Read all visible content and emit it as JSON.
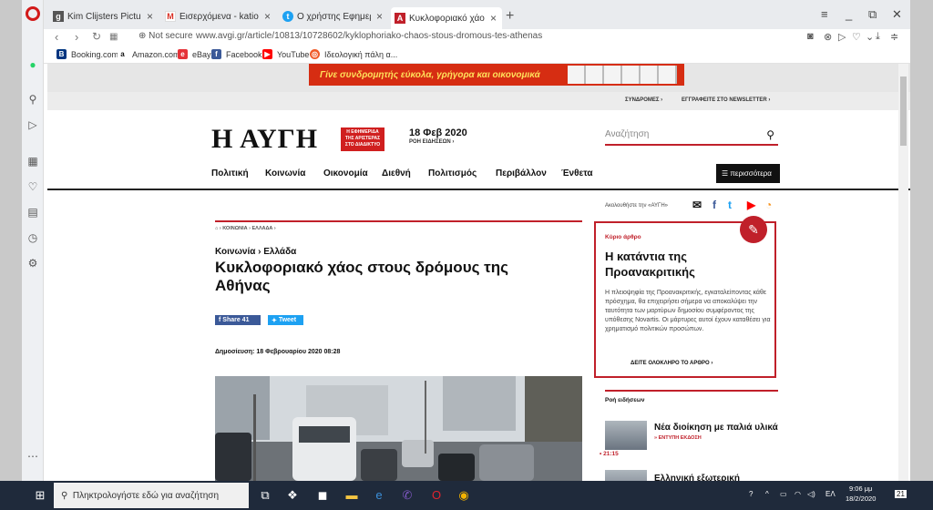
{
  "browser": {
    "tabs": [
      {
        "favicon": "g",
        "title": "Kim Clijsters Pictures and I",
        "color": "#555555"
      },
      {
        "favicon": "M",
        "title": "Εισερχόμενα - katiousa.gr",
        "color": "#d93025"
      },
      {
        "favicon": "t",
        "title": "Ο χρήστης Εφημερίδα Η Α",
        "color": "#1da1f2"
      },
      {
        "favicon": "A",
        "title": "Κυκλοφοριακό χάος στου",
        "color": "#c0202a"
      }
    ],
    "security_label": "Not secure",
    "url": "www.avgi.gr/article/10813/10728602/kyklophoriako-chaos-stous-dromous-tes-athenas",
    "bookmarks": [
      {
        "label": "Booking.com",
        "icon": "booking-icon",
        "color": "#003580"
      },
      {
        "label": "Amazon.com",
        "icon": "amazon-icon",
        "color": "#111111"
      },
      {
        "label": "eBay",
        "icon": "ebay-icon",
        "color": "#e53238"
      },
      {
        "label": "Facebook",
        "icon": "facebook-icon",
        "color": "#3b5998"
      },
      {
        "label": "YouTube",
        "icon": "youtube-icon",
        "color": "#ff0000"
      },
      {
        "label": "Ιδεολογική πάλη α...",
        "icon": "ideologiki-icon",
        "color": "#f05a28"
      }
    ]
  },
  "ad": {
    "text": "Γίνε συνδρομητής εύκολα, γρήγορα και οικονομικά"
  },
  "topbar": {
    "subscriptions": "ΣΥΝΔΡΟΜΕΣ ›",
    "newsletter": "ΕΓΓΡΑΦΕΙΤΕ ΣΤΟ NEWSLETTER ›"
  },
  "site": {
    "logo": "Η ΑΥΓΗ",
    "logo_tagline": "Η ΕΦΗΜΕΡΙΔΑ ΤΗΣ ΑΡΙΣΤΕΡΑΣ ΣΤΟ ΔΙΑΔΙΚΤΥΟ",
    "date": "18 Φεβ 2020",
    "news_flow": "ΡΟΗ ΕΙΔΗΣΕΩΝ ›",
    "search_placeholder": "Αναζήτηση",
    "menu": [
      "Πολιτική",
      "Κοινωνία",
      "Οικονομία",
      "Διεθνή",
      "Πολιτισμός",
      "Περιβάλλον",
      "Ένθετα"
    ],
    "more": "περισσότερα",
    "follow": "Ακολουθήστε την «ΑΥΓΗ»"
  },
  "article": {
    "breadcrumb": "⌂ ›  ΚΟΙΝΩΝΙΑ ›  ΕΛΛΑΔΑ ›",
    "category": "Κοινωνία › Ελλάδα",
    "headline": "Κυκλοφοριακό χάος στους δρόμους της Αθήνας",
    "share_label": "Share 41",
    "tweet_label": "Tweet",
    "published": "Δημοσίευση: 18 Φεβρουαρίου 2020 08:28"
  },
  "main_article": {
    "label": "Κύριο άρθρο",
    "title": "Η κατάντια της Προανακριτικής",
    "body": "Η πλειοψηφία της Προανακριτικής, εγκαταλείποντας κάθε πρόσχημα, θα επιχειρήσει σήμερα να αποκαλύψει την ταυτότητα των μαρτύρων δημοσίου συμφέροντος της υπόθεσης Novartis. Οι μάρτυρες αυτοί έχουν καταθέσει για χρηματισμό πολιτικών προσώπων.",
    "read_all": "ΔΕΙΤΕ ΟΛΟΚΛΗΡΟ ΤΟ ΑΡΘΡΟ ›"
  },
  "news_feed": {
    "title": "Ροή ειδήσεων",
    "items": [
      {
        "headline": "Νέα διοίκηση με παλιά υλικά",
        "tag": "» ΕΝΤΥΠΗ ΕΚΔΟΣΗ",
        "time": "21:15"
      },
      {
        "headline": "Ελληνική εξωτερική",
        "tag": "",
        "time": ""
      }
    ]
  },
  "taskbar": {
    "search_placeholder": "Πληκτρολογήστε εδώ για αναζήτηση",
    "language": "ΕΛ",
    "time": "9:06 μμ",
    "date": "18/2/2020",
    "notification_count": "21"
  }
}
